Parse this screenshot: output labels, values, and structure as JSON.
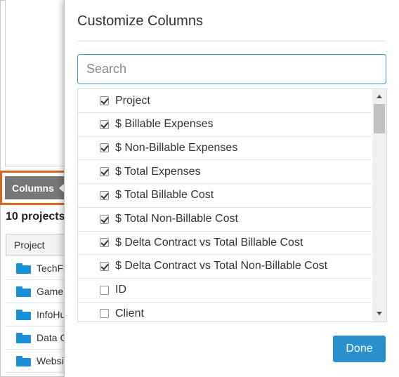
{
  "background": {
    "columns_button_label": "Columns",
    "projects_count": "10 projects",
    "table_header": "Project",
    "rows": [
      "TechFair",
      "Game",
      "InfoHub",
      "Data Center",
      "Website"
    ]
  },
  "modal": {
    "title": "Customize Columns",
    "search_placeholder": "Search",
    "search_value": "",
    "items": [
      {
        "label": "Project",
        "checked": true
      },
      {
        "label": "$ Billable Expenses",
        "checked": true
      },
      {
        "label": "$ Non-Billable Expenses",
        "checked": true
      },
      {
        "label": "$ Total Expenses",
        "checked": true
      },
      {
        "label": "$ Total Billable Cost",
        "checked": true
      },
      {
        "label": "$ Total Non-Billable Cost",
        "checked": true
      },
      {
        "label": "$ Delta Contract vs Total Billable Cost",
        "checked": true
      },
      {
        "label": "$ Delta Contract vs Total Non-Billable Cost",
        "checked": true
      },
      {
        "label": "ID",
        "checked": false
      },
      {
        "label": "Client",
        "checked": false
      }
    ],
    "done_label": "Done"
  },
  "colors": {
    "highlight": "#d9661f",
    "columns_button": "#777777",
    "folder": "#1b8fd6",
    "accent": "#2a8fcb"
  }
}
